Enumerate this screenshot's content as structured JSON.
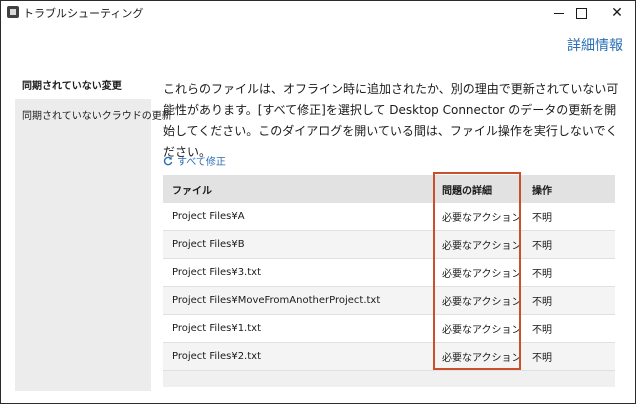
{
  "window": {
    "title": "トラブルシューティング",
    "minimize_icon": "minimize-icon",
    "maximize_icon": "maximize-icon",
    "close_icon": "close-icon"
  },
  "header": {
    "details_link": "詳細情報"
  },
  "sidebar": {
    "items": [
      {
        "label": "同期されていない変更",
        "active": true
      },
      {
        "label": "同期されていないクラウドの更新",
        "active": false
      }
    ]
  },
  "main": {
    "description": "これらのファイルは、オフライン時に追加されたか、別の理由で更新されていない可能性があります。[すべて修正]を選択して Desktop Connector のデータの更新を開始してください。このダイアログを開いている間は、ファイル操作を実行しないでください。",
    "fix_all_label": "すべて修正",
    "fix_all_icon": "refresh-icon"
  },
  "table": {
    "headers": {
      "file": "ファイル",
      "detail": "問題の詳細",
      "action": "操作"
    },
    "rows": [
      {
        "file": "Project Files¥A",
        "detail": "必要なアクション",
        "action": "不明"
      },
      {
        "file": "Project Files¥B",
        "detail": "必要なアクション",
        "action": "不明"
      },
      {
        "file": "Project Files¥3.txt",
        "detail": "必要なアクション",
        "action": "不明"
      },
      {
        "file": "Project Files¥MoveFromAnotherProject.txt",
        "detail": "必要なアクション",
        "action": "不明"
      },
      {
        "file": "Project Files¥1.txt",
        "detail": "必要なアクション",
        "action": "不明"
      },
      {
        "file": "Project Files¥2.txt",
        "detail": "必要なアクション",
        "action": "不明"
      }
    ]
  },
  "colors": {
    "link": "#2a6fb5",
    "highlight": "#c9502a",
    "sidebar_bg": "#ececec",
    "table_header_bg": "#e2e2e2"
  }
}
